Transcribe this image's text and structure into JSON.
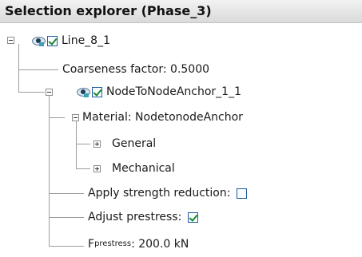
{
  "panel": {
    "title": "Selection explorer (Phase_3)"
  },
  "tree": {
    "line": {
      "label": "Line_8_1",
      "checked": true
    },
    "coarseness": {
      "label": "Coarseness factor: 0.5000"
    },
    "anchor": {
      "label": "NodeToNodeAnchor_1_1",
      "checked": true
    },
    "material": {
      "label": "Material: NodetonodeAnchor"
    },
    "general": {
      "label": "General"
    },
    "mechanical": {
      "label": "Mechanical"
    },
    "apply_strength_reduction": {
      "label": "Apply strength reduction:",
      "checked": false
    },
    "adjust_prestress": {
      "label": "Adjust prestress:",
      "checked": true
    },
    "f_prestress": {
      "symbol": "F",
      "subscript": "prestress",
      "value": ": 200.0 kN"
    }
  },
  "colors": {
    "header_bg": "#dadada",
    "checkbox_border": "#1c5d9e",
    "checkmark": "#138a2b",
    "tree_line": "#9c9c9c"
  },
  "icons": {
    "visibility": "eye-icon",
    "collapse": "minus-box-icon",
    "expand": "plus-box-icon",
    "checkbox": "checkbox-icon"
  }
}
